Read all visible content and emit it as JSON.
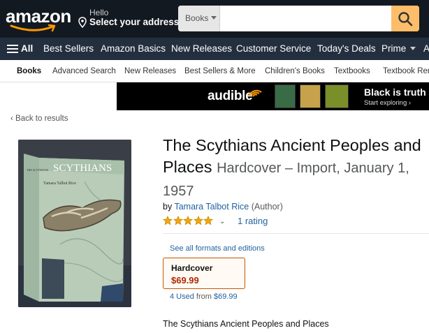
{
  "header": {
    "logo_text": "amazon",
    "hello": "Hello",
    "select_address": "Select your address",
    "search": {
      "category": "Books",
      "placeholder": ""
    }
  },
  "nav": {
    "all": "All",
    "items": [
      "Best Sellers",
      "Amazon Basics",
      "New Releases",
      "Customer Service",
      "Today's Deals",
      "Prime",
      "A"
    ]
  },
  "subnav": {
    "items": [
      "Books",
      "Advanced Search",
      "New Releases",
      "Best Sellers & More",
      "Children's Books",
      "Textbooks",
      "Textbook Ren"
    ]
  },
  "banner": {
    "brand": "audible",
    "headline": "Black is truth",
    "cta": "Start exploring ›",
    "cover_colors": [
      "#3a6b47",
      "#c8a24a",
      "#7a8f2a",
      "#b8b060"
    ]
  },
  "back_link": "‹ Back to results",
  "product": {
    "title": "The Scythians Ancient Peoples and Places",
    "format_inline": "Hardcover – Import, January 1, 1957",
    "by": "by",
    "author": "Tamara Talbot Rice",
    "author_role": "(Author)",
    "stars": 5,
    "rating_text": "1 rating",
    "formats_link": "See all formats and editions",
    "format_box": {
      "name": "Hardcover",
      "price": "$69.99"
    },
    "used": {
      "count": "4 Used",
      "from": "from",
      "price": "$69.99"
    },
    "description": "The Scythians Ancient Peoples and Places",
    "cover_spine": "THE SCYTHIANS",
    "cover_title": "SCYTHIANS",
    "cover_author": "Tamara Talbot Rice"
  },
  "colors": {
    "topbar": "#131921",
    "navbar": "#232f3e",
    "search_button": "#febd69",
    "link": "#2162a1",
    "price": "#b12704",
    "star": "#f0a80c"
  }
}
